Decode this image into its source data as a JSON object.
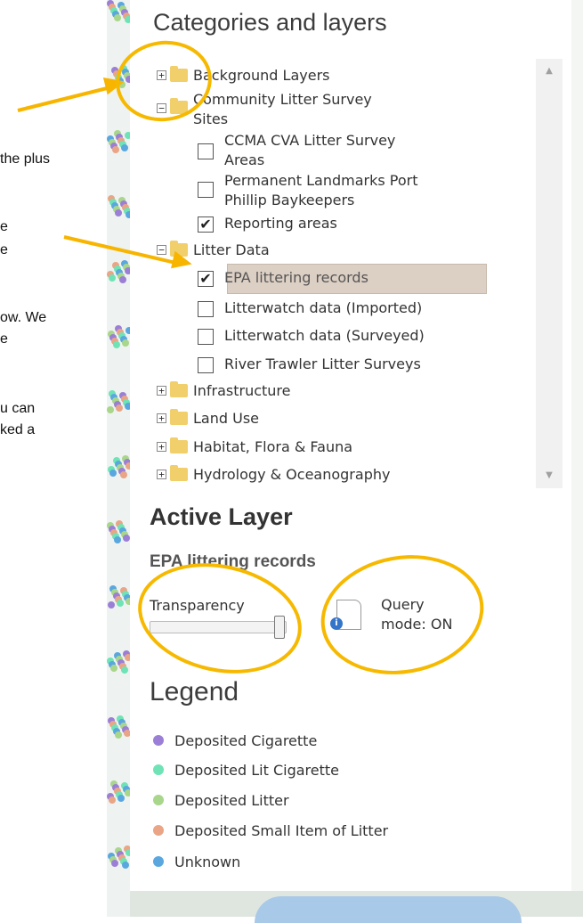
{
  "side_text": [
    "the plus",
    "e",
    "e",
    "ow. We",
    "e",
    "u can",
    "ked a"
  ],
  "panel": {
    "title": "Categories and layers",
    "tree": {
      "background_layers": "Background Layers",
      "community_litter": "Community Litter Survey\nSites",
      "ccma": "CCMA CVA Litter Survey\nAreas",
      "permanent": "Permanent Landmarks Port\nPhillip Baykeepers",
      "reporting": "Reporting areas",
      "litter_data": "Litter Data",
      "epa": "EPA littering records",
      "lw_imported": "Litterwatch data (Imported)",
      "lw_surveyed": "Litterwatch data (Surveyed)",
      "river_trawler": "River Trawler Litter Surveys",
      "infrastructure": "Infrastructure",
      "land_use": "Land Use",
      "habitat": "Habitat, Flora & Fauna",
      "hydrology": "Hydrology & Oceanography"
    },
    "checks": {
      "ccma": false,
      "permanent": false,
      "reporting": true,
      "epa": true,
      "lw_imported": false,
      "lw_surveyed": false,
      "river_trawler": false
    },
    "expanders": {
      "collapsed": "+",
      "expanded": "−"
    },
    "active_layer": {
      "heading": "Active Layer",
      "name": "EPA littering records",
      "transparency_label": "Transparency",
      "transparency_fraction": 0.95,
      "query_mode": "Query\nmode: ON"
    },
    "legend": {
      "heading": "Legend",
      "items": [
        {
          "label": "Deposited Cigarette",
          "color": "#9b7fd6"
        },
        {
          "label": "Deposited Lit Cigarette",
          "color": "#6fe3b6"
        },
        {
          "label": "Deposited Litter",
          "color": "#a8d68b"
        },
        {
          "label": "Deposited Small Item of Litter",
          "color": "#e9a586"
        },
        {
          "label": "Unknown",
          "color": "#5aa7df"
        }
      ]
    }
  },
  "annotation_color": "#f6b900"
}
